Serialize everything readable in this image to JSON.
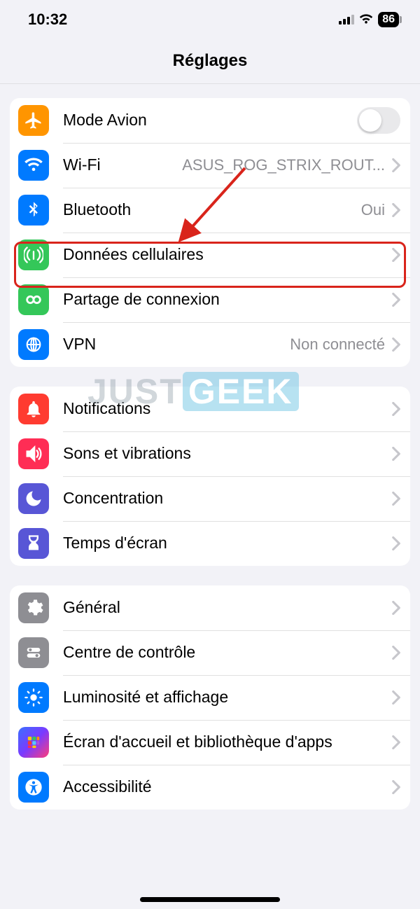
{
  "status": {
    "time": "10:32",
    "battery": "86"
  },
  "title": "Réglages",
  "watermark": {
    "a": "JUST",
    "b": "GEEK"
  },
  "groups": [
    {
      "rows": [
        {
          "icon": "airplane",
          "color": "#ff9500",
          "label": "Mode Avion",
          "control": "toggle"
        },
        {
          "icon": "wifi",
          "color": "#007aff",
          "label": "Wi-Fi",
          "value": "ASUS_ROG_STRIX_ROUT...",
          "control": "chevron"
        },
        {
          "icon": "bluetooth",
          "color": "#007aff",
          "label": "Bluetooth",
          "value": "Oui",
          "control": "chevron"
        },
        {
          "icon": "cellular",
          "color": "#34c759",
          "label": "Données cellulaires",
          "control": "chevron",
          "highlighted": true
        },
        {
          "icon": "hotspot",
          "color": "#34c759",
          "label": "Partage de connexion",
          "control": "chevron"
        },
        {
          "icon": "vpn",
          "color": "#007aff",
          "label": "VPN",
          "value": "Non connecté",
          "control": "chevron"
        }
      ]
    },
    {
      "rows": [
        {
          "icon": "notifications",
          "color": "#ff3b30",
          "label": "Notifications",
          "control": "chevron"
        },
        {
          "icon": "sounds",
          "color": "#ff2d55",
          "label": "Sons et vibrations",
          "control": "chevron"
        },
        {
          "icon": "focus",
          "color": "#5856d6",
          "label": "Concentration",
          "control": "chevron"
        },
        {
          "icon": "screentime",
          "color": "#5856d6",
          "label": "Temps d'écran",
          "control": "chevron"
        }
      ]
    },
    {
      "rows": [
        {
          "icon": "general",
          "color": "#8e8e93",
          "label": "Général",
          "control": "chevron"
        },
        {
          "icon": "controlcenter",
          "color": "#8e8e93",
          "label": "Centre de contrôle",
          "control": "chevron"
        },
        {
          "icon": "display",
          "color": "#007aff",
          "label": "Luminosité et affichage",
          "control": "chevron"
        },
        {
          "icon": "homescreen",
          "gradient": true,
          "label": "Écran d'accueil et bibliothèque d'apps",
          "control": "chevron"
        },
        {
          "icon": "accessibility",
          "color": "#007aff",
          "label": "Accessibilité",
          "control": "chevron"
        }
      ]
    }
  ]
}
